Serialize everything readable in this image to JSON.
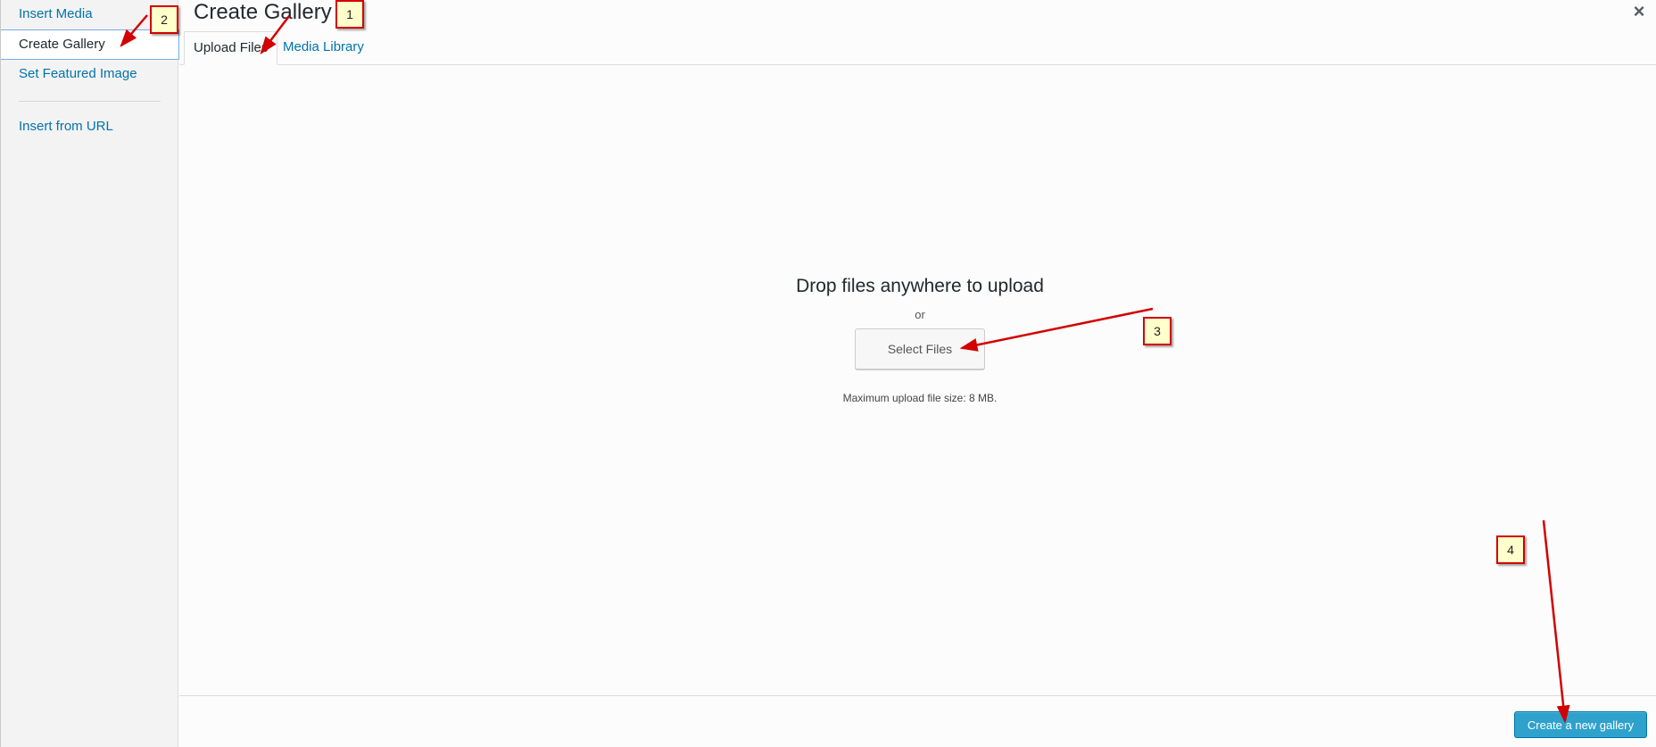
{
  "sidebar": {
    "items": [
      {
        "label": "Insert Media"
      },
      {
        "label": "Create Gallery"
      },
      {
        "label": "Set Featured Image"
      },
      {
        "label": "Insert from URL"
      }
    ]
  },
  "frame": {
    "title": "Create Gallery",
    "close": "×",
    "tabs": [
      {
        "label": "Upload Files"
      },
      {
        "label": "Media Library"
      }
    ]
  },
  "uploader": {
    "drop_text": "Drop files anywhere to upload",
    "or_text": "or",
    "select_button": "Select Files",
    "max_size": "Maximum upload file size: 8 MB."
  },
  "toolbar": {
    "create_button": "Create a new gallery"
  },
  "annotations": [
    "1",
    "2",
    "3",
    "4"
  ],
  "colors": {
    "link": "#0073aa",
    "primary_button": "#2ea2cc",
    "callout_border": "#d20000",
    "callout_fill": "#ffffcc"
  }
}
